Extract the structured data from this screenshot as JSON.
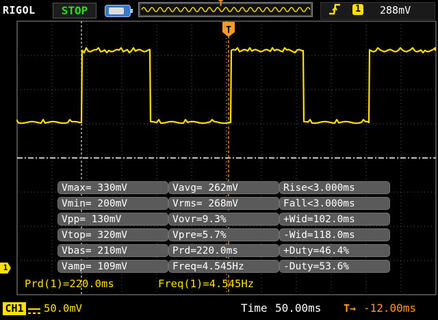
{
  "header": {
    "brand": "RIGOL",
    "run_state": "STOP",
    "trigger_edge_icon": "rising-edge-icon",
    "trigger_channel": "1",
    "trigger_level": "288mV",
    "trigger_position_marker": "T"
  },
  "screen": {
    "trigger_marker": "T",
    "colors": {
      "trace": "#ffe000",
      "grid": "#6a6a6a",
      "trigger": "#ff9a22",
      "background": "#000000"
    }
  },
  "channel_marker": "1",
  "measurements": [
    [
      "Vmax= 330mV",
      "Vavg= 262mV",
      "Rise<3.000ms"
    ],
    [
      "Vmin= 200mV",
      "Vrms= 268mV",
      "Fall<3.000ms"
    ],
    [
      "Vpp= 130mV",
      "Vovr=9.3%",
      "+Wid=102.0ms"
    ],
    [
      "Vtop= 320mV",
      "Vpre=5.7%",
      "-Wid=118.0ms"
    ],
    [
      "Vbas= 210mV",
      "Prd=220.0ms",
      "+Duty=46.4%"
    ],
    [
      "Vamp= 109mV",
      "Freq=4.545Hz",
      "-Duty=53.6%"
    ]
  ],
  "quick": {
    "period": "Prd(1)=220.0ms",
    "frequency": "Freq(1)=4.545Hz"
  },
  "footer": {
    "channel_label": "CH1",
    "coupling_icon": "dc-coupling-icon",
    "channel_scale": "50.0mV",
    "time_label": "Time",
    "time_scale": "50.00ms",
    "offset_icon": "trigger-offset-icon",
    "offset_icon_text": "T→",
    "trigger_offset": "-12.00ms"
  }
}
